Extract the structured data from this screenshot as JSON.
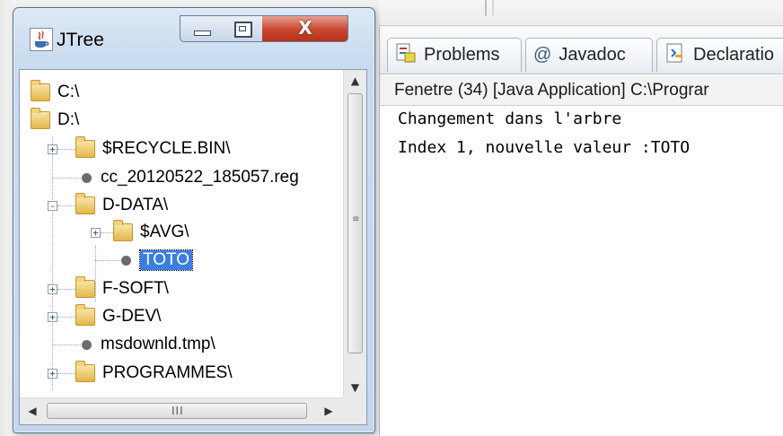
{
  "jtree_window": {
    "title": "JTree",
    "controls": {
      "minimize": "minimize",
      "maximize": "maximize",
      "close_glyph": "X"
    },
    "tree": {
      "items": [
        {
          "label": "C:\\",
          "type": "folder"
        },
        {
          "label": "D:\\",
          "type": "folder"
        },
        {
          "label": "$RECYCLE.BIN\\",
          "type": "folder",
          "expander": "+"
        },
        {
          "label": "cc_20120522_185057.reg",
          "type": "file"
        },
        {
          "label": "D-DATA\\",
          "type": "folder",
          "expander": "-"
        },
        {
          "label": "$AVG\\",
          "type": "folder",
          "expander": "+"
        },
        {
          "label": "TOTO",
          "type": "file",
          "selected": true
        },
        {
          "label": "F-SOFT\\",
          "type": "folder",
          "expander": "+"
        },
        {
          "label": "G-DEV\\",
          "type": "folder",
          "expander": "+"
        },
        {
          "label": "msdownld.tmp\\",
          "type": "file"
        },
        {
          "label": "PROGRAMMES\\",
          "type": "folder",
          "expander": "+"
        }
      ]
    },
    "scrollbars": {
      "up": "▲",
      "down": "▼",
      "left": "◀",
      "right": "▶",
      "grip_v": "≡",
      "grip_h": "III"
    }
  },
  "eclipse": {
    "tabs": [
      {
        "label": "Problems",
        "icon": "problems-icon"
      },
      {
        "label": "Javadoc",
        "icon": "at-icon",
        "glyph": "@"
      },
      {
        "label": "Declaratio",
        "icon": "declaration-icon"
      }
    ],
    "console_header": "Fenetre (34) [Java Application] C:\\Prograr",
    "console_lines": [
      "Changement dans l'arbre",
      "Index 1, nouvelle valeur :TOTO"
    ]
  }
}
